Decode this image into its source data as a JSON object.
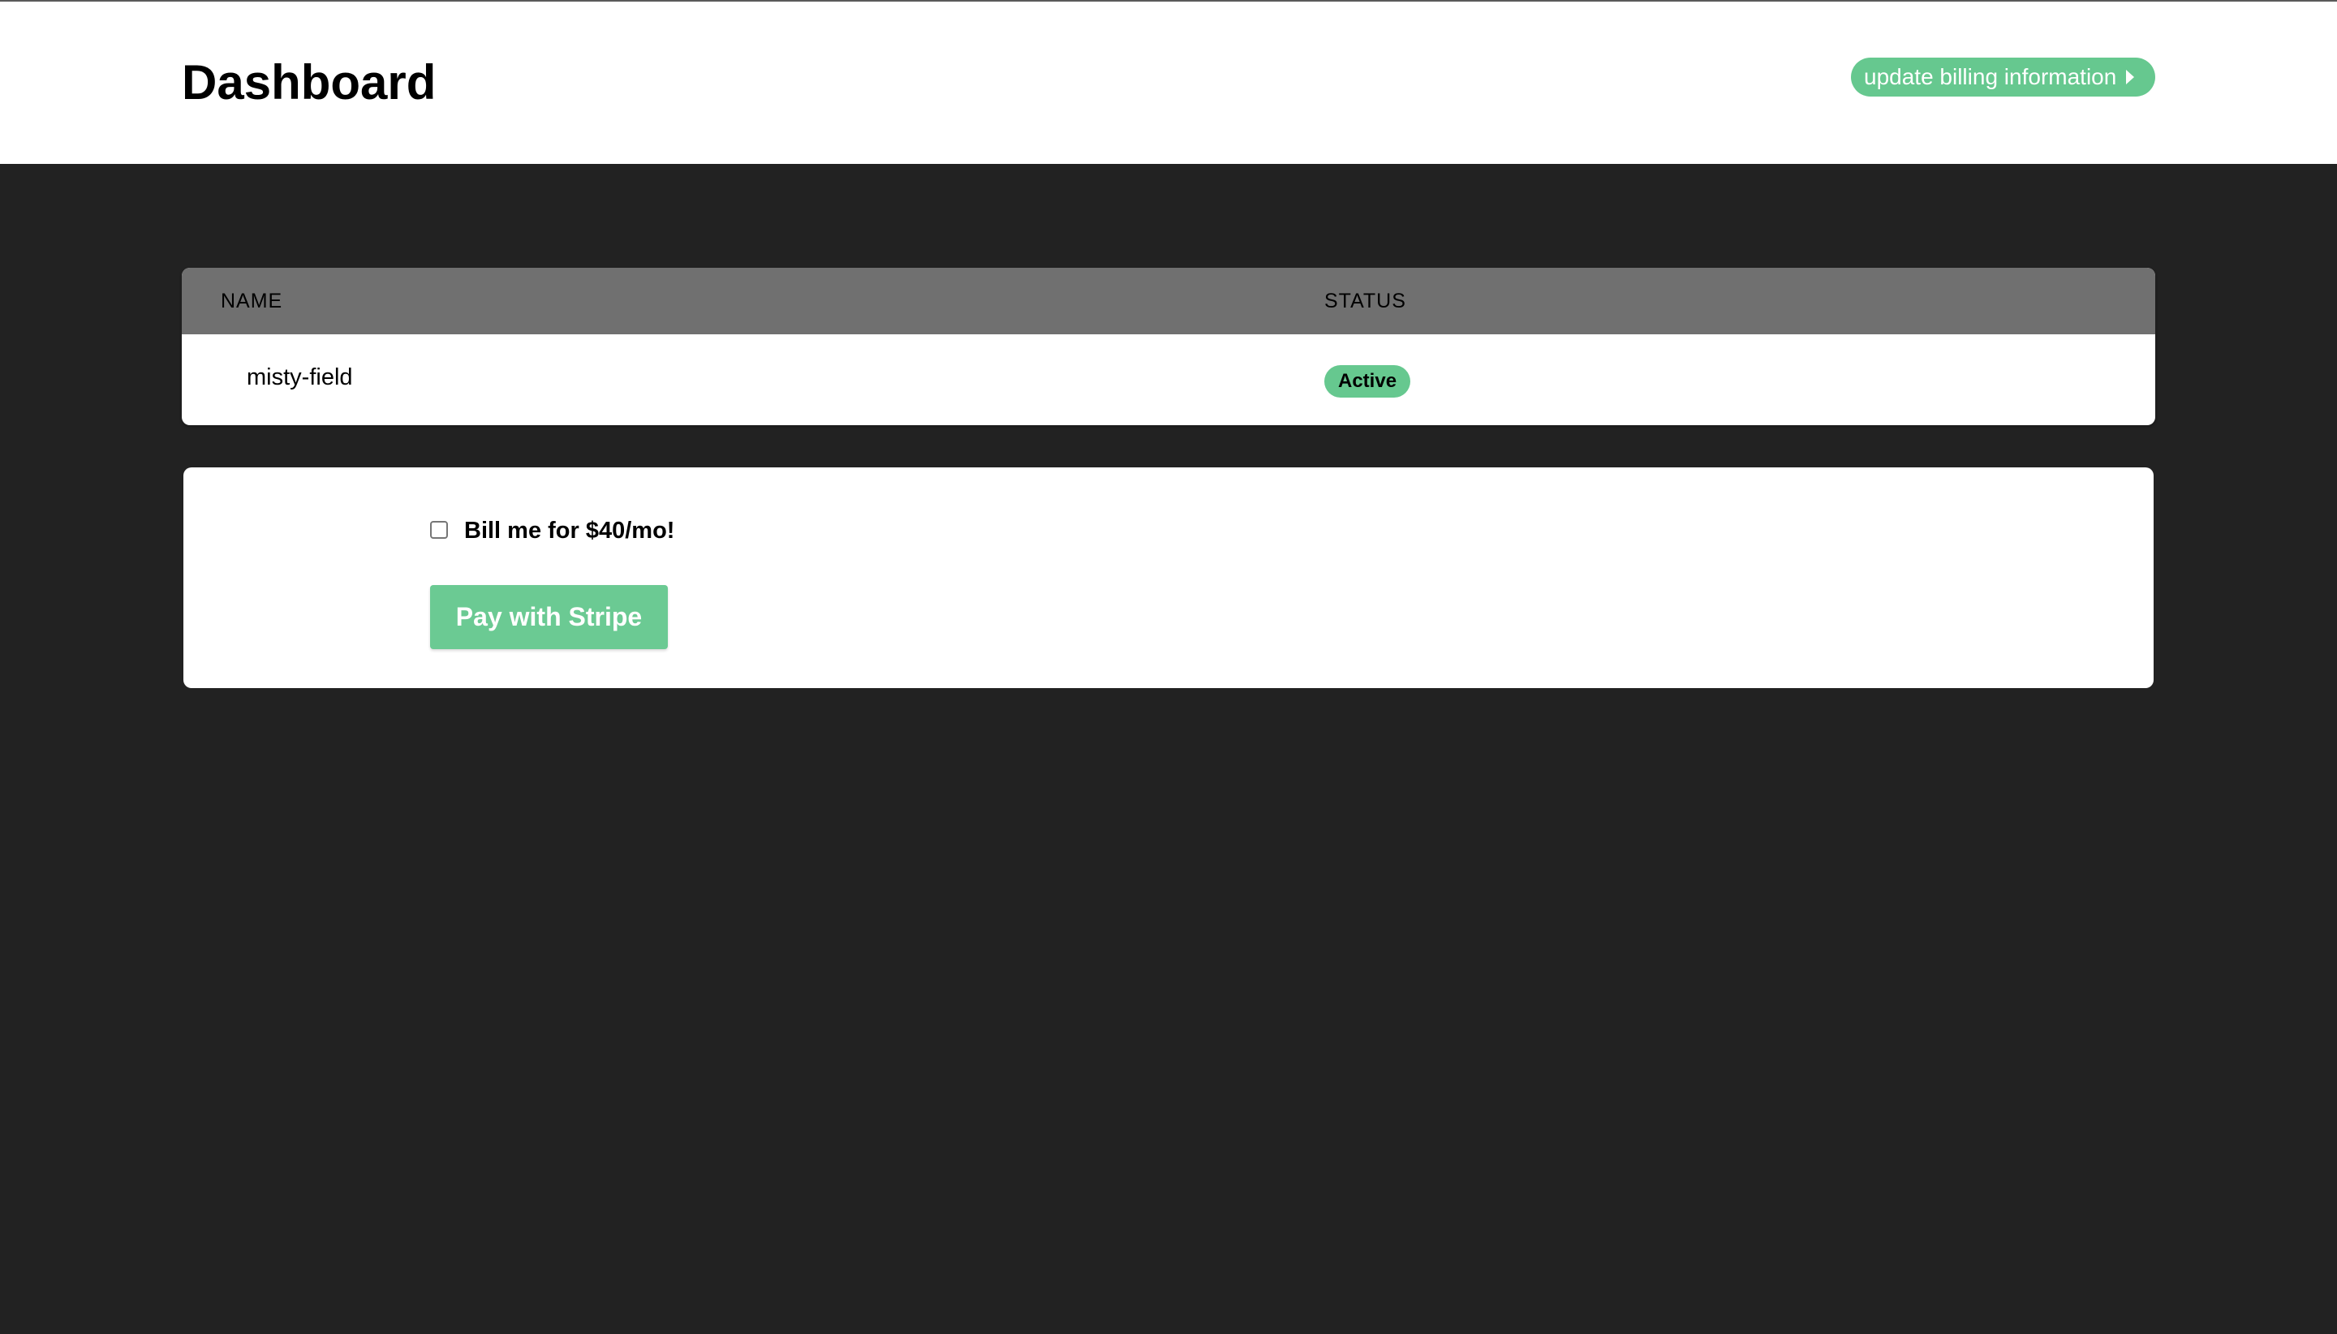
{
  "header": {
    "title": "Dashboard",
    "billing_button_label": "update billing information",
    "billing_button_icon": "chevron-right-icon"
  },
  "table": {
    "columns": [
      "NAME",
      "STATUS"
    ],
    "rows": [
      {
        "name": "misty-field",
        "status": "Active"
      }
    ]
  },
  "payment": {
    "checkbox_label": "Bill me for $40/mo!",
    "checkbox_checked": false,
    "pay_button_label": "Pay with Stripe"
  },
  "colors": {
    "accent_green": "#66c88f",
    "page_background": "#222222",
    "table_header_background": "#707070"
  }
}
